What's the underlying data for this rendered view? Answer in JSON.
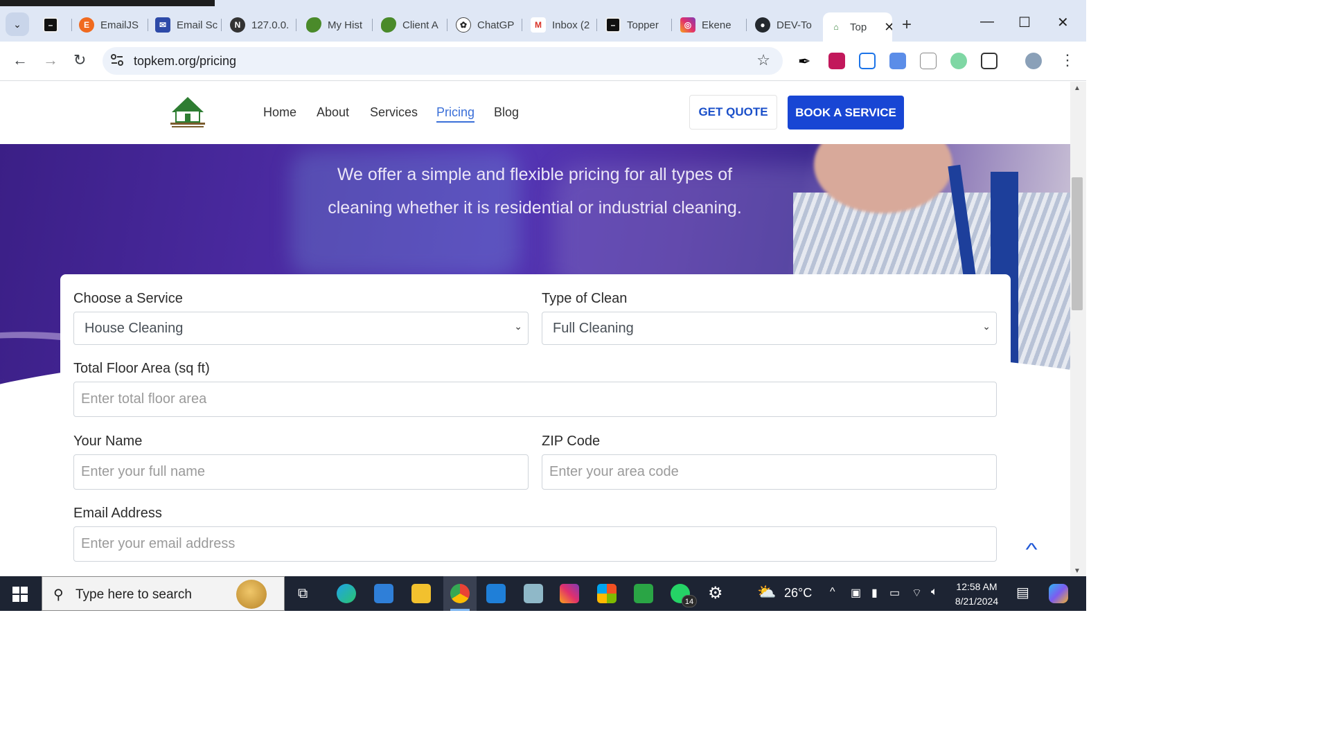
{
  "browser": {
    "tabs": [
      {
        "label": "",
        "icon": "black-square-icon"
      },
      {
        "label": "EmailJS",
        "icon": "emailjs-icon"
      },
      {
        "label": "Email Sc",
        "icon": "email-shield-icon"
      },
      {
        "label": "127.0.0.",
        "icon": "refresh-circle-icon"
      },
      {
        "label": "My Hist",
        "icon": "africa-map-icon"
      },
      {
        "label": "Client A",
        "icon": "africa-map-icon"
      },
      {
        "label": "ChatGP",
        "icon": "chatgpt-icon"
      },
      {
        "label": "Inbox (2",
        "icon": "gmail-icon"
      },
      {
        "label": "Topper",
        "icon": "black-square-icon"
      },
      {
        "label": "Ekene",
        "icon": "instagram-icon"
      },
      {
        "label": "DEV-To",
        "icon": "github-icon"
      },
      {
        "label": "Top",
        "icon": "topkem-logo-icon"
      }
    ],
    "new_tab": "+",
    "url": "topkem.org/pricing"
  },
  "site": {
    "nav": {
      "home": "Home",
      "about": "About",
      "services": "Services",
      "pricing": "Pricing",
      "blog": "Blog",
      "active": "Pricing"
    },
    "buttons": {
      "quote": "GET QUOTE",
      "book": "BOOK A SERVICE"
    },
    "hero_text": "We offer a simple and flexible pricing for all types of cleaning whether it is residential or industrial cleaning.",
    "form": {
      "service_label": "Choose a Service",
      "service_value": "House Cleaning",
      "clean_label": "Type of Clean",
      "clean_value": "Full Cleaning",
      "area_label": "Total Floor Area (sq ft)",
      "area_placeholder": "Enter total floor area",
      "name_label": "Your Name",
      "name_placeholder": "Enter your full name",
      "zip_label": "ZIP Code",
      "zip_placeholder": "Enter your area code",
      "email_label": "Email Address",
      "email_placeholder": "Enter your email address"
    }
  },
  "taskbar": {
    "search_placeholder": "Type here to search",
    "weather": "26°C",
    "time": "12:58 AM",
    "date": "8/21/2024",
    "whatsapp_badge": "14"
  },
  "colors": {
    "accent_blue": "#1846d4",
    "nav_active": "#3a6fd8",
    "hero_purple": "#4a2aa0"
  }
}
